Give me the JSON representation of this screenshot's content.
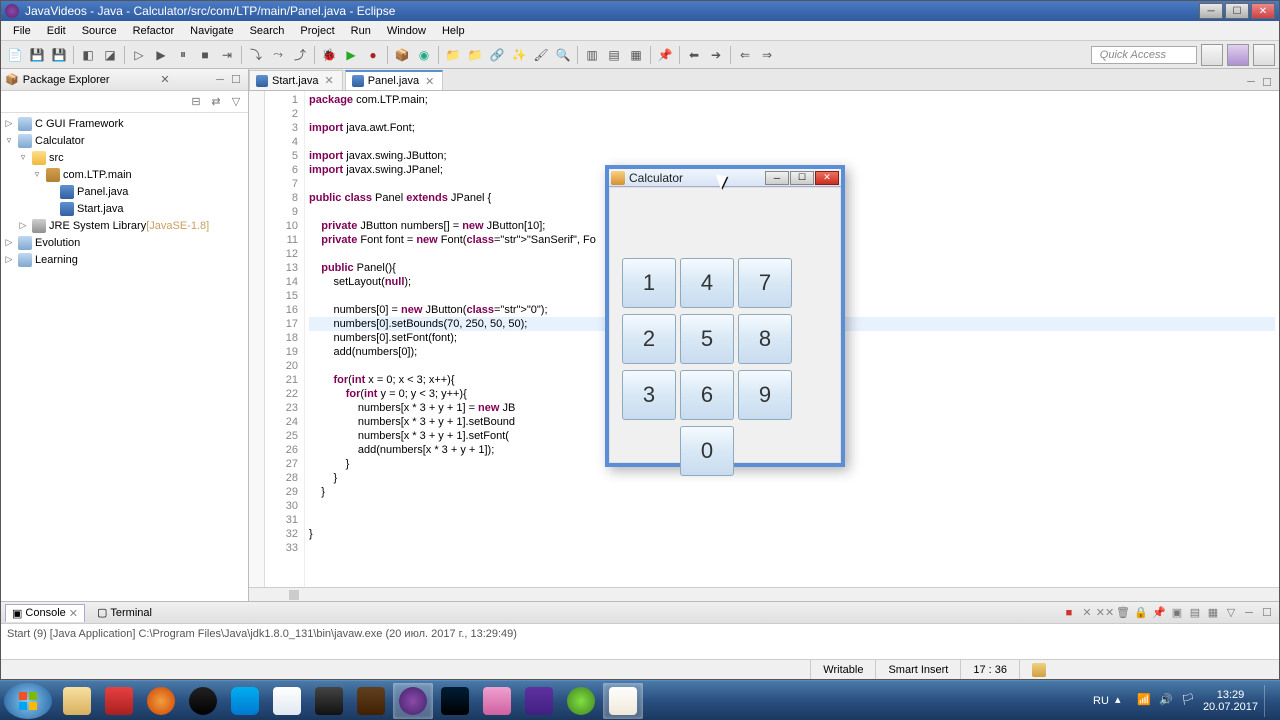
{
  "window": {
    "title": "JavaVideos - Java - Calculator/src/com/LTP/main/Panel.java - Eclipse"
  },
  "menubar": [
    "File",
    "Edit",
    "Source",
    "Refactor",
    "Navigate",
    "Search",
    "Project",
    "Run",
    "Window",
    "Help"
  ],
  "quick_access": "Quick Access",
  "package_explorer": {
    "title": "Package Explorer",
    "tree": [
      {
        "label": "C GUI Framework",
        "indent": 0,
        "toggle": "▷",
        "icon": "proj-icon"
      },
      {
        "label": "Calculator",
        "indent": 0,
        "toggle": "▿",
        "icon": "proj-icon"
      },
      {
        "label": "src",
        "indent": 1,
        "toggle": "▿",
        "icon": "folder-icon"
      },
      {
        "label": "com.LTP.main",
        "indent": 2,
        "toggle": "▿",
        "icon": "package-icon"
      },
      {
        "label": "Panel.java",
        "indent": 3,
        "toggle": "",
        "icon": "java-icon"
      },
      {
        "label": "Start.java",
        "indent": 3,
        "toggle": "",
        "icon": "java-icon"
      },
      {
        "label": "JRE System Library",
        "suffix": "[JavaSE-1.8]",
        "indent": 1,
        "toggle": "▷",
        "icon": "lib-icon"
      },
      {
        "label": "Evolution",
        "indent": 0,
        "toggle": "▷",
        "icon": "proj-icon"
      },
      {
        "label": "Learning",
        "indent": 0,
        "toggle": "▷",
        "icon": "proj-icon"
      }
    ]
  },
  "editor": {
    "tabs": [
      {
        "label": "Start.java",
        "active": false
      },
      {
        "label": "Panel.java",
        "active": true
      }
    ],
    "lines": [
      {
        "n": 1,
        "text": "package com.LTP.main;",
        "hl": false
      },
      {
        "n": 2,
        "text": "",
        "hl": false
      },
      {
        "n": 3,
        "text": "import java.awt.Font;",
        "hl": false
      },
      {
        "n": 4,
        "text": "",
        "hl": false
      },
      {
        "n": 5,
        "text": "import javax.swing.JButton;",
        "hl": false
      },
      {
        "n": 6,
        "text": "import javax.swing.JPanel;",
        "hl": false
      },
      {
        "n": 7,
        "text": "",
        "hl": false
      },
      {
        "n": 8,
        "text": "public class Panel extends JPanel {",
        "hl": false
      },
      {
        "n": 9,
        "text": "",
        "hl": false
      },
      {
        "n": 10,
        "text": "    private JButton numbers[] = new JButton[10];",
        "hl": false
      },
      {
        "n": 11,
        "text": "    private Font font = new Font(\"SanSerif\", Fo",
        "hl": false
      },
      {
        "n": 12,
        "text": "",
        "hl": false
      },
      {
        "n": 13,
        "text": "    public Panel(){",
        "hl": false
      },
      {
        "n": 14,
        "text": "        setLayout(null);",
        "hl": false
      },
      {
        "n": 15,
        "text": "",
        "hl": false
      },
      {
        "n": 16,
        "text": "        numbers[0] = new JButton(\"0\");",
        "hl": false
      },
      {
        "n": 17,
        "text": "        numbers[0].setBounds(70, 250, 50, 50);",
        "hl": true
      },
      {
        "n": 18,
        "text": "        numbers[0].setFont(font);",
        "hl": false
      },
      {
        "n": 19,
        "text": "        add(numbers[0]);",
        "hl": false
      },
      {
        "n": 20,
        "text": "",
        "hl": false
      },
      {
        "n": 21,
        "text": "        for(int x = 0; x < 3; x++){",
        "hl": false
      },
      {
        "n": 22,
        "text": "            for(int y = 0; y < 3; y++){",
        "hl": false
      },
      {
        "n": 23,
        "text": "                numbers[x * 3 + y + 1] = new JB",
        "hl": false
      },
      {
        "n": 24,
        "text": "                numbers[x * 3 + y + 1].setBound                                    70, 50, 50);",
        "hl": false
      },
      {
        "n": 25,
        "text": "                numbers[x * 3 + y + 1].setFont(",
        "hl": false
      },
      {
        "n": 26,
        "text": "                add(numbers[x * 3 + y + 1]);",
        "hl": false
      },
      {
        "n": 27,
        "text": "            }",
        "hl": false
      },
      {
        "n": 28,
        "text": "        }",
        "hl": false
      },
      {
        "n": 29,
        "text": "    }",
        "hl": false
      },
      {
        "n": 30,
        "text": "",
        "hl": false
      },
      {
        "n": 31,
        "text": "    ",
        "hl": false
      },
      {
        "n": 32,
        "text": "}",
        "hl": false
      },
      {
        "n": 33,
        "text": "",
        "hl": false
      }
    ]
  },
  "console": {
    "title": "Console",
    "terminal": "Terminal",
    "text": "Start (9) [Java Application] C:\\Program Files\\Java\\jdk1.8.0_131\\bin\\javaw.exe (20 июл. 2017 г., 13:29:49)"
  },
  "statusbar": {
    "writable": "Writable",
    "insert": "Smart Insert",
    "position": "17 : 36"
  },
  "calculator": {
    "title": "Calculator",
    "buttons": [
      "1",
      "4",
      "7",
      "2",
      "5",
      "8",
      "3",
      "6",
      "9"
    ],
    "zero": "0"
  },
  "tray": {
    "lang": "RU",
    "time": "13:29",
    "date": "20.07.2017"
  }
}
